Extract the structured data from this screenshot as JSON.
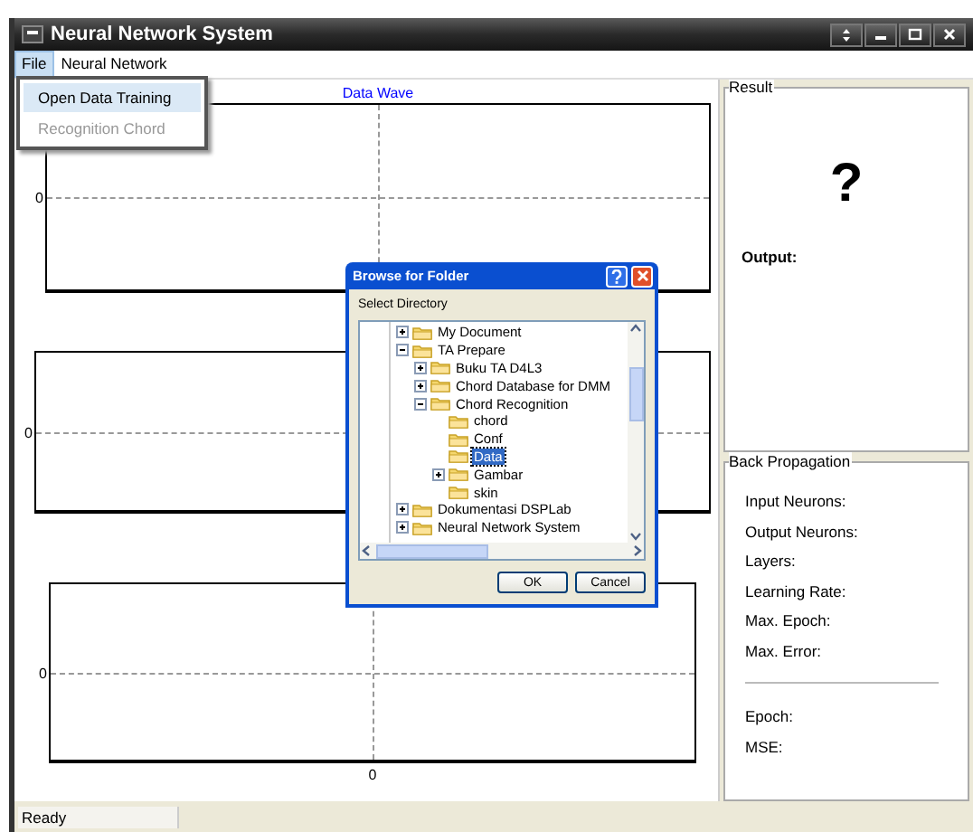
{
  "window": {
    "title": "Neural Network System"
  },
  "menu_bar": [
    {
      "label": "File",
      "selected": true
    },
    {
      "label": "Neural Network",
      "selected": false
    }
  ],
  "file_menu": [
    {
      "label": "Open Data Training",
      "selected": true,
      "disabled": false
    },
    {
      "label": "Recognition Chord",
      "selected": false,
      "disabled": true
    }
  ],
  "plots": [
    {
      "title": "Data Wave",
      "y_tick": "0"
    },
    {
      "y_tick": "0"
    },
    {
      "y_tick": "0",
      "x_tick": "0"
    }
  ],
  "result": {
    "title": "Result",
    "value": "?",
    "output_label": "Output:"
  },
  "back_propagation": {
    "title": "Back Propagation",
    "fields": [
      "Input Neurons:",
      "Output Neurons:",
      "Layers:",
      "Learning Rate:",
      "Max. Epoch:",
      "Max. Error:"
    ],
    "stats": [
      "Epoch:",
      "MSE:"
    ]
  },
  "dialog": {
    "title": "Browse for Folder",
    "prompt": "Select Directory",
    "tree": [
      {
        "label": "My Document",
        "expanded": false,
        "selected": false
      },
      {
        "label": "TA Prepare",
        "expanded": true,
        "selected": false,
        "children": [
          {
            "label": "Buku TA D4L3",
            "expanded": false,
            "selected": false
          },
          {
            "label": "Chord Database for DMM",
            "expanded": false,
            "selected": false
          },
          {
            "label": "Chord Recognition",
            "expanded": true,
            "selected": false,
            "children": [
              {
                "label": "chord",
                "selected": false
              },
              {
                "label": "Conf",
                "selected": false
              },
              {
                "label": "Data",
                "selected": true
              },
              {
                "label": "Gambar",
                "expanded": false,
                "selected": false
              },
              {
                "label": "skin",
                "selected": false
              }
            ]
          }
        ]
      },
      {
        "label": "Dokumentasi DSPLab",
        "expanded": false,
        "selected": false
      },
      {
        "label": "Neural Network System",
        "expanded": false,
        "selected": false
      }
    ],
    "buttons": [
      "OK",
      "Cancel"
    ]
  },
  "status_bar": {
    "text": "Ready"
  }
}
